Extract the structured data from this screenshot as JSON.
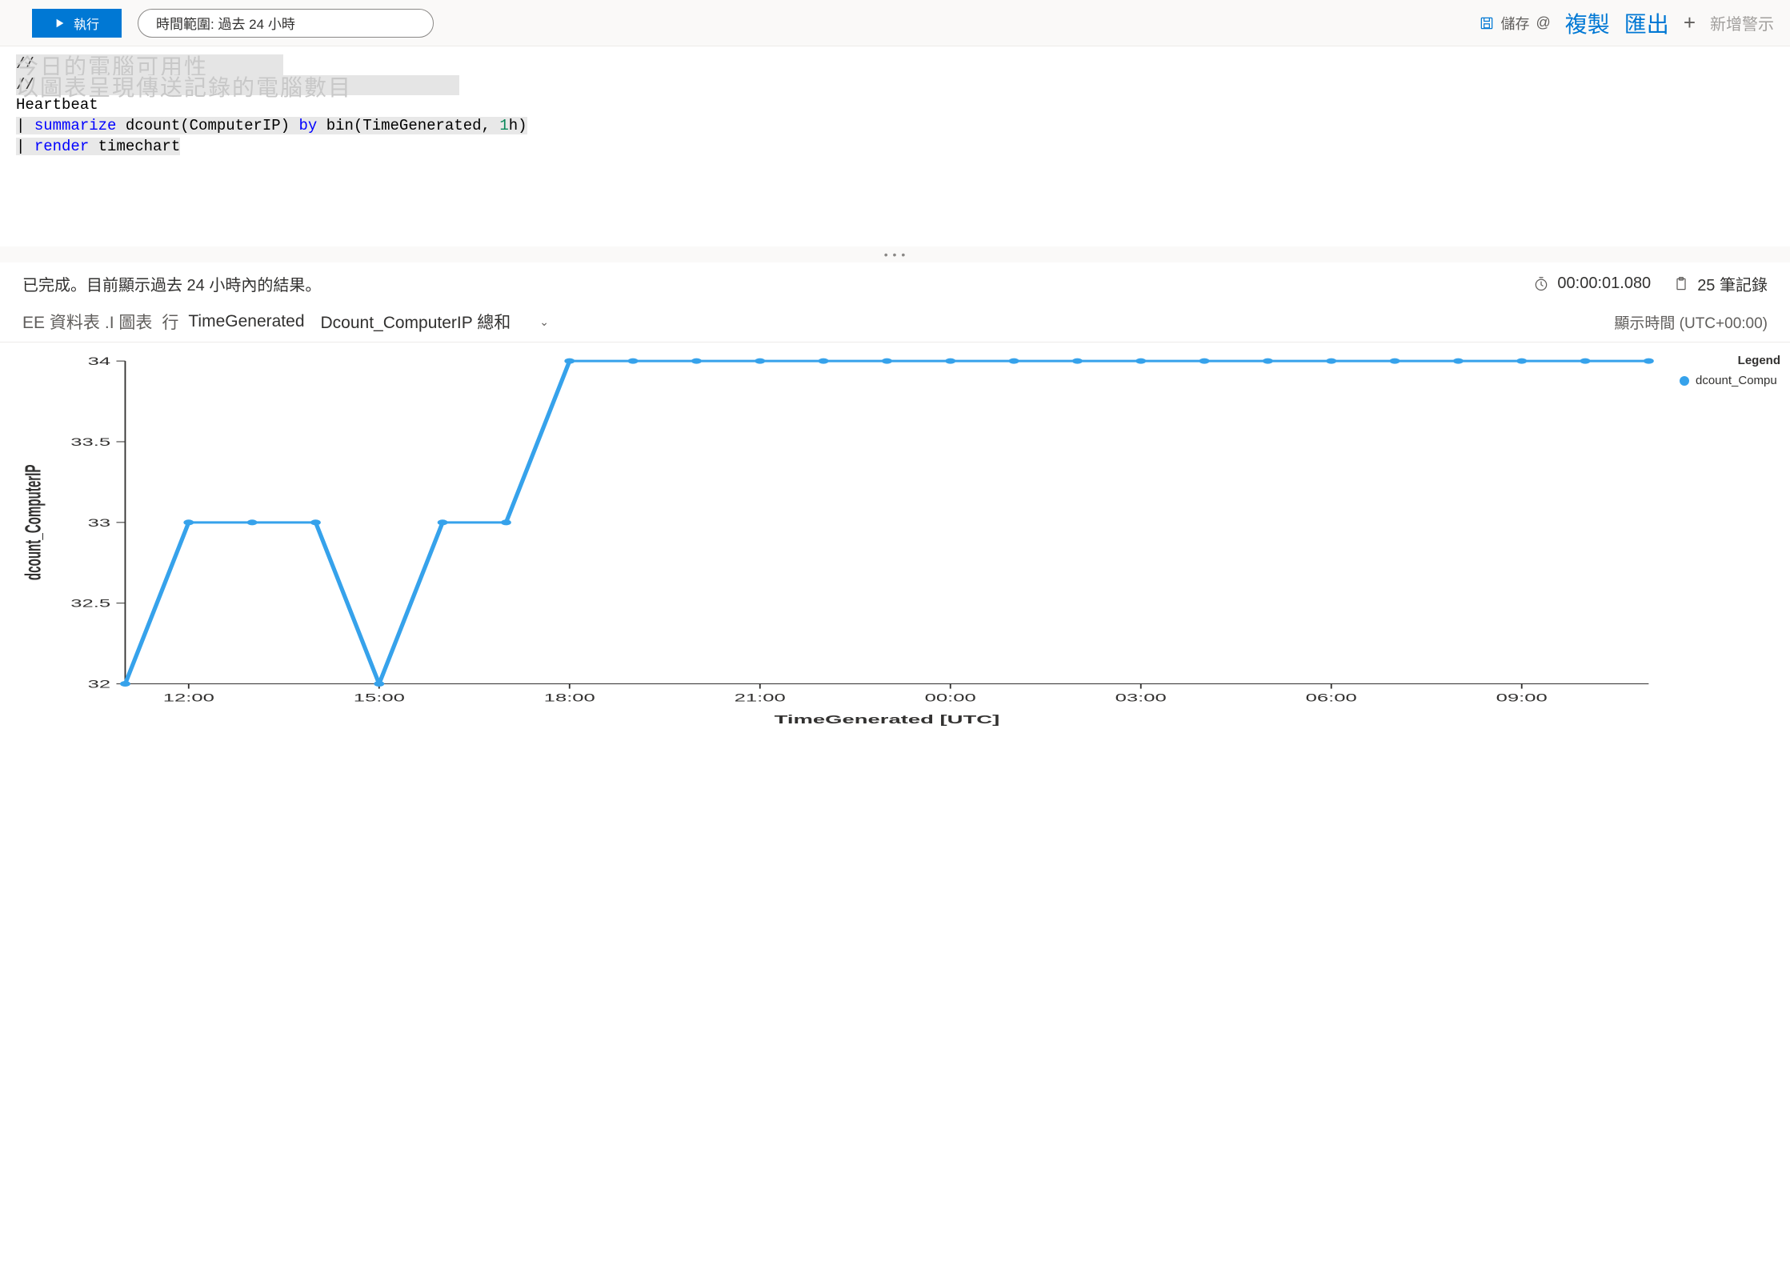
{
  "toolbar": {
    "run_label": "執行",
    "time_range": "時間範圍: 過去 24 小時",
    "save_label": "儲存",
    "at_label": "@",
    "copy_label": "複製",
    "export_label": "匯出",
    "plus_label": "+",
    "new_alert_label": "新增警示"
  },
  "code": {
    "comment1_prefix": "// ",
    "comment1_overlay": "今日的電腦可用性",
    "comment2_prefix": "// ",
    "comment2_overlay": "以圖表呈現傳送記錄的電腦數目",
    "l3": "Heartbeat",
    "l4_pipe": "| ",
    "l4_kw": "summarize",
    "l4_rest1": " dcount(ComputerIP) ",
    "l4_by": "by",
    "l4_rest2": " bin(TimeGenerated, ",
    "l4_num": "1",
    "l4_unit": "h)",
    "l5_pipe": "| ",
    "l5_kw": "render",
    "l5_rest": " timechart"
  },
  "status": {
    "done_text": "已完成。目前顯示過去 24 小時內的結果。",
    "elapsed": "00:00:01.080",
    "records": "25 筆記錄"
  },
  "tabs": {
    "table_tab": "EE 資料表",
    "chart_tab": ".I 圖表",
    "row_label": "行",
    "col1": "TimeGenerated",
    "col2": "Dcount_ComputerIP 總和",
    "tz_label": "顯示時間 (UTC+00:00)"
  },
  "legend": {
    "title": "Legend",
    "series": "dcount_Compu"
  },
  "chart_data": {
    "type": "line",
    "xlabel": "TimeGenerated [UTC]",
    "ylabel": "dcount_ComputerIP",
    "ylim": [
      32,
      34
    ],
    "yticks": [
      32,
      32.5,
      33,
      33.5,
      34
    ],
    "xticks_labels": [
      "12:00",
      "15:00",
      "18:00",
      "21:00",
      "00:00",
      "03:00",
      "06:00",
      "09:00"
    ],
    "xticks_idx": [
      1,
      4,
      7,
      10,
      13,
      16,
      19,
      22
    ],
    "series": [
      {
        "name": "dcount_ComputerIP",
        "color": "#36a2eb",
        "values": [
          32,
          33,
          33,
          33,
          32,
          33,
          33,
          34,
          34,
          34,
          34,
          34,
          34,
          34,
          34,
          34,
          34,
          34,
          34,
          34,
          34,
          34,
          34,
          34,
          34
        ]
      }
    ]
  }
}
